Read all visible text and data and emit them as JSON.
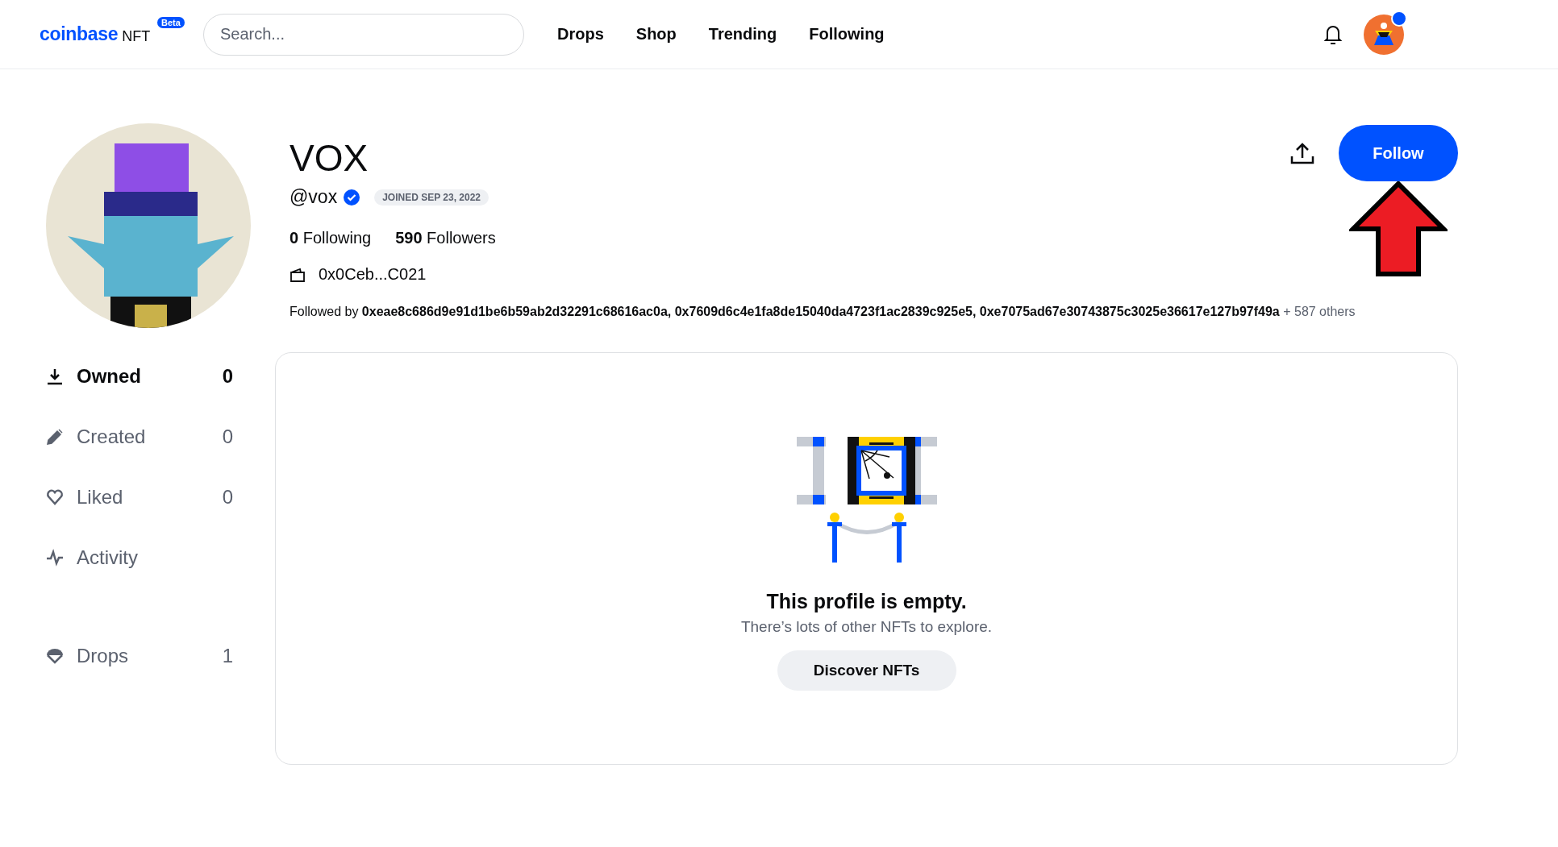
{
  "header": {
    "logo": {
      "brand": "coinbase",
      "product": "NFT",
      "badge": "Beta"
    },
    "search": {
      "placeholder": "Search..."
    },
    "nav": [
      {
        "label": "Drops"
      },
      {
        "label": "Shop"
      },
      {
        "label": "Trending"
      },
      {
        "label": "Following"
      }
    ],
    "notifications_unread": true
  },
  "profile": {
    "name": "VOX",
    "handle": "@vox",
    "verified": true,
    "joined": "JOINED SEP 23, 2022",
    "stats": [
      {
        "count": "0",
        "label": "Following"
      },
      {
        "count": "590",
        "label": "Followers"
      }
    ],
    "wallet": "0x0Ceb...C021",
    "followed_by": "Followed by **0xeae8c686d9e91d1be6b59ab2d32291c68616ac0a, 0x7609d6c4e1fa8de15040da4723f1ac2839c925e5, 0xe7075ad67e30743875c3025e36617e127b97f49a**",
    "followed_more": "+ 587 others",
    "follow_button": "Follow"
  },
  "sidebar": {
    "sections": [
      [
        {
          "label": "Owned",
          "count": "0",
          "selected": true
        },
        {
          "label": "Created",
          "count": "0",
          "selected": false
        },
        {
          "label": "Liked",
          "count": "0",
          "selected": false
        },
        {
          "label": "Activity",
          "selected": false
        }
      ],
      [
        {
          "label": "Drops",
          "count": "1",
          "selected": false
        }
      ]
    ]
  },
  "empty_state": {
    "title": "This profile is empty.",
    "text": "There’s lots of other NFTs to explore.",
    "button": "Discover NFTs"
  }
}
